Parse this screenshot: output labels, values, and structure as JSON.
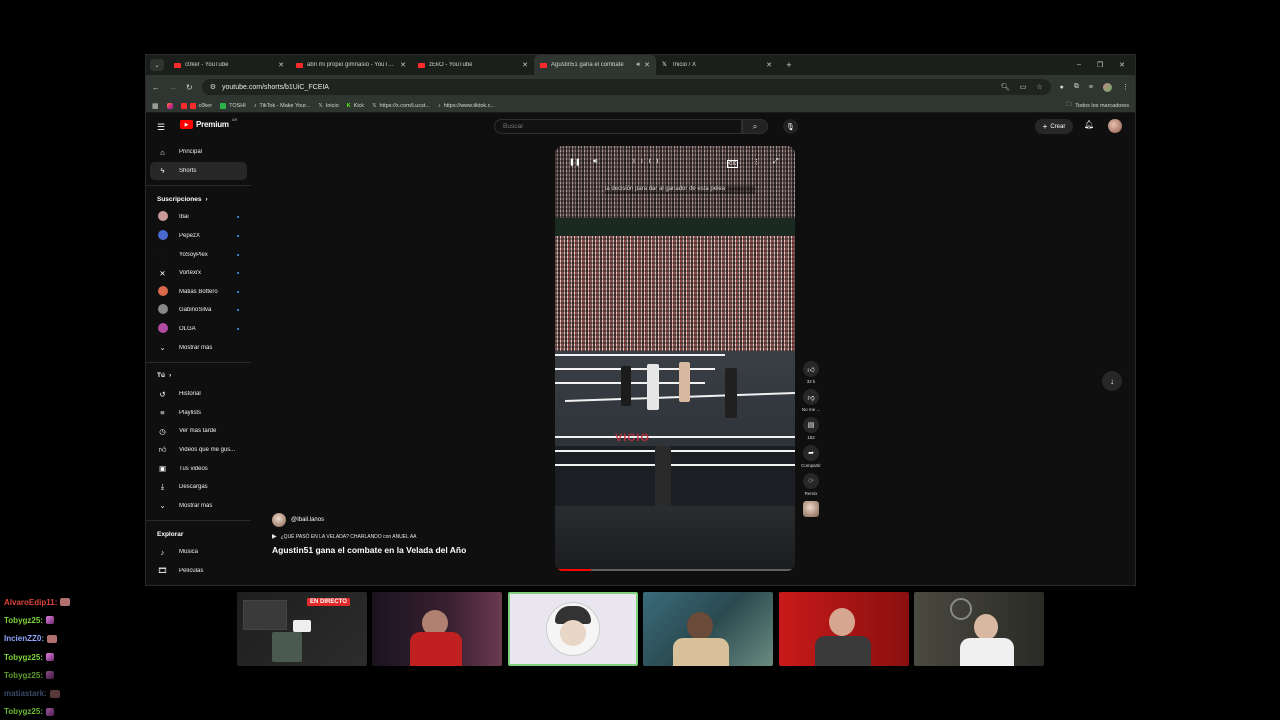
{
  "browser": {
    "tabs": [
      {
        "title": "c0ker - YouTube",
        "icon": "youtube-icon",
        "active": false
      },
      {
        "title": "abri mi propio gimnasio - YouTube",
        "icon": "youtube-icon",
        "active": false
      },
      {
        "title": "zEkO - YouTube",
        "icon": "youtube-icon",
        "active": false
      },
      {
        "title": "Agustin51 gana el combate",
        "icon": "youtube-icon",
        "active": true
      },
      {
        "title": "Inicio / X",
        "icon": "x-icon",
        "active": false
      }
    ],
    "url": "youtube.com/shorts/b1UiC_FCEIA",
    "bookmarks": [
      {
        "label": "c0ker",
        "color": "#ff2a2a"
      },
      {
        "label": "TOSHI",
        "color": "#2bb34a"
      },
      {
        "label": "TikTok - Make Your...",
        "color": "#222"
      },
      {
        "label": "Inicio",
        "color": "#222"
      },
      {
        "label": "Kick",
        "color": "#53fc18"
      },
      {
        "label": "https://x.com/Lucst...",
        "color": "#222"
      },
      {
        "label": "https://www.tiktok.c...",
        "color": "#222"
      }
    ],
    "bookmarks_all": "Todos los marcadores"
  },
  "youtube": {
    "logo": "Premium",
    "logo_region": "AR",
    "search_placeholder": "Buscar",
    "create_label": "Crear",
    "nav": [
      {
        "label": "Principal",
        "icon": "home-icon"
      },
      {
        "label": "Shorts",
        "icon": "shorts-icon"
      }
    ],
    "subscriptions_title": "Suscripciones",
    "subscriptions": [
      {
        "label": "Ibai",
        "color": "#c99"
      },
      {
        "label": "PepezX",
        "color": "#4a6ad0"
      },
      {
        "label": "YoSoyPlex",
        "color": "#111"
      },
      {
        "label": "Vortexrx",
        "color": "#ffffff"
      },
      {
        "label": "Matias Bottero",
        "color": "#d86a4a"
      },
      {
        "label": "GabinoSilva",
        "color": "#888"
      },
      {
        "label": "OLGA",
        "color": "#b04aa0"
      }
    ],
    "show_more": "Mostrar más",
    "you_title": "Tú",
    "you_items": [
      {
        "label": "Historial",
        "icon": "history-icon"
      },
      {
        "label": "Playlists",
        "icon": "playlist-icon"
      },
      {
        "label": "Ver más tarde",
        "icon": "clock-icon"
      },
      {
        "label": "Videos que me gus...",
        "icon": "like-icon"
      },
      {
        "label": "Tus videos",
        "icon": "video-icon"
      },
      {
        "label": "Descargas",
        "icon": "download-icon"
      }
    ],
    "show_more_2": "Mostrar más",
    "explore_title": "Explorar",
    "explore_items": [
      {
        "label": "Música",
        "icon": "music-icon"
      },
      {
        "label": "Películas",
        "icon": "film-icon"
      }
    ],
    "short": {
      "channel": "@Ibail.lanos",
      "link_text": "¿QUÉ PASÓ EN LA VELADA? CHARLANDO con ANUEL AA",
      "title": "Agustin51 gana el combate en la Velada del Año",
      "caption": "la decisión para dar al ganador de esta pelea",
      "apron_text": "VICIO",
      "progress": 0.15
    },
    "actions": [
      {
        "icon": "thumbs-up-icon",
        "label": "32 k"
      },
      {
        "icon": "thumbs-down-icon",
        "label": "No me ..."
      },
      {
        "icon": "comment-icon",
        "label": "152"
      },
      {
        "icon": "share-icon",
        "label": "Compartir"
      },
      {
        "icon": "remix-icon",
        "label": "Remix"
      }
    ]
  },
  "stream": {
    "chat": [
      {
        "user": "AlvaroEdip11:",
        "color": "#e0443c",
        "emote": "face"
      },
      {
        "user": "Tobygz25:",
        "color": "#7cd33a",
        "emote": "pen"
      },
      {
        "user": "IncienZZ0:",
        "color": "#8fa6ff",
        "emote": "face"
      },
      {
        "user": "Tobygz25:",
        "color": "#7cd33a",
        "emote": "pen"
      },
      {
        "user": "Tobygz25:",
        "color": "#5e9a2c",
        "emote": "pen"
      },
      {
        "user": "matiastark:",
        "color": "#3a4a6a",
        "emote": "face"
      },
      {
        "user": "Tobygz25:",
        "color": "#6cb832",
        "emote": "pen"
      }
    ],
    "live_badge": "EN DIRECTO"
  }
}
